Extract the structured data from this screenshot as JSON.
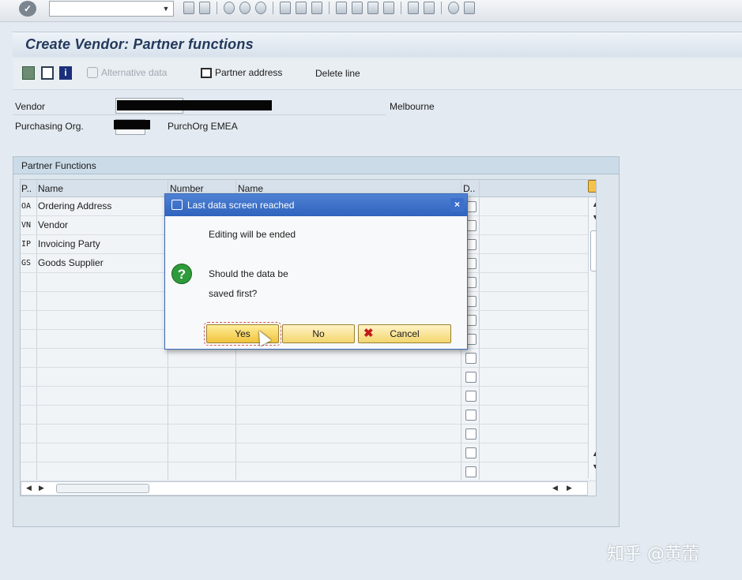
{
  "colors": {
    "title_text": "#23395b",
    "dialog_title": "#2f63bd",
    "button_yellow": "#f3d66e",
    "question_green": "#2e9b3a",
    "cancel_red": "#c21a1a"
  },
  "systembar": {
    "icons": [
      "enter-icon",
      "back-icon",
      "save-icon",
      "back-nav-icon",
      "exit-icon",
      "cancel-icon",
      "print-icon",
      "find-icon",
      "find-next-icon",
      "first-page-icon",
      "prev-page-icon",
      "next-page-icon",
      "last-page-icon",
      "create-session-icon",
      "shortcut-icon",
      "help-icon",
      "layout-icon"
    ]
  },
  "title": "Create Vendor: Partner functions",
  "toolbar": {
    "alternative_data": "Alternative data",
    "partner_address": "Partner address",
    "delete_line": "Delete line"
  },
  "header": {
    "vendor_label": "Vendor",
    "vendor_city": "Melbourne",
    "purch_org_label": "Purchasing Org.",
    "purch_org_text": "PurchOrg EMEA"
  },
  "partner_functions": {
    "title": "Partner Functions",
    "columns": {
      "p": "P..",
      "name": "Name",
      "number": "Number",
      "name2": "Name",
      "d": "D.."
    },
    "rows": [
      {
        "code": "OA",
        "name": "Ordering Address"
      },
      {
        "code": "VN",
        "name": "Vendor"
      },
      {
        "code": "IP",
        "name": "Invoicing Party"
      },
      {
        "code": "GS",
        "name": "Goods Supplier"
      }
    ]
  },
  "dialog": {
    "title": "Last data screen reached",
    "close": "×",
    "line1": "Editing will be ended",
    "line2": "Should the data be",
    "line3": "saved first?",
    "yes": "Yes",
    "no": "No",
    "cancel": "Cancel"
  },
  "watermark": "知乎 @黄蕾"
}
